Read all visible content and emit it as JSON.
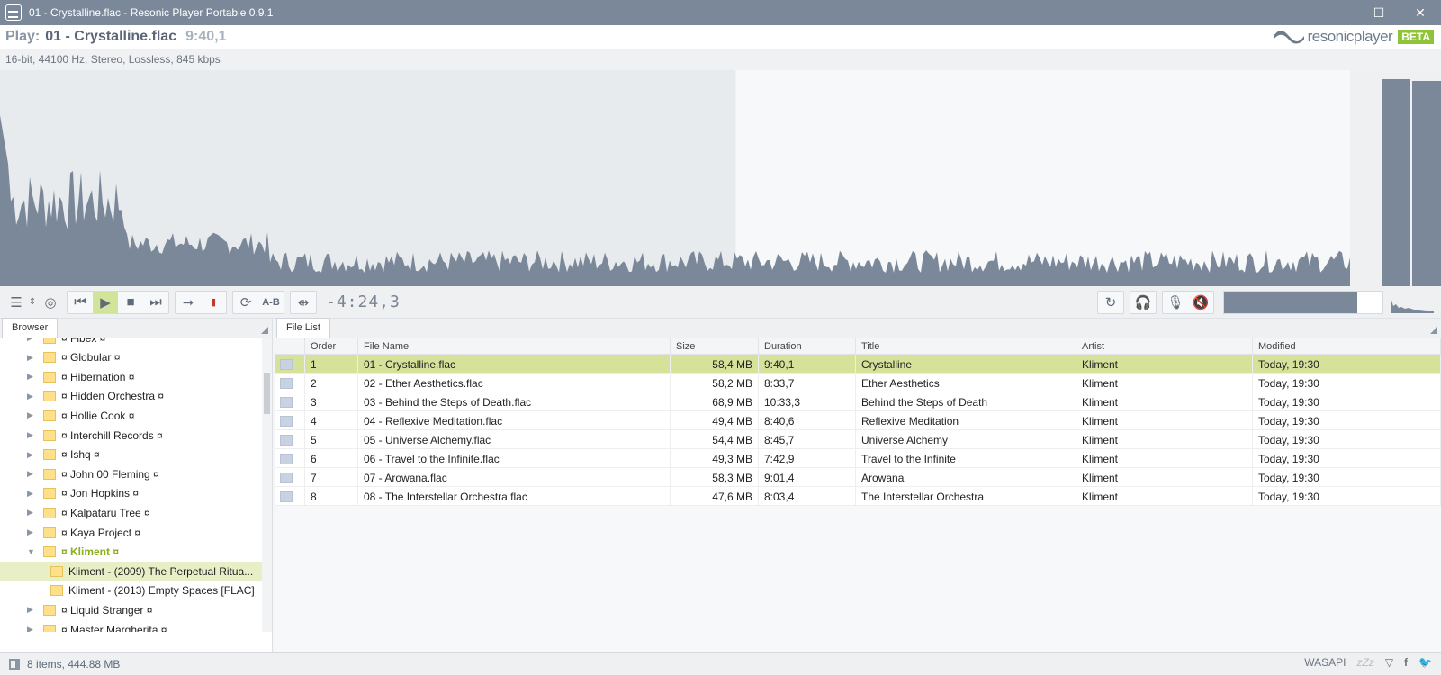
{
  "window": {
    "title": "01 - Crystalline.flac - Resonic Player Portable 0.9.1",
    "minimize": "—",
    "maximize": "☐",
    "close": "✕"
  },
  "header": {
    "play_label": "Play:",
    "file": "01 - Crystalline.flac",
    "time": "9:40,1",
    "brand": "resonicplayer",
    "beta": "BETA"
  },
  "info": "16-bit, 44100 Hz, Stereo, Lossless, 845 kbps",
  "playback": {
    "progress": 0.545,
    "volume": 0.84
  },
  "controls": {
    "time_remaining": "-4:24,3",
    "ab_label": "A-B"
  },
  "browser": {
    "tab": "Browser",
    "items": [
      {
        "label": "¤ Flbex ¤",
        "arrow": "▶"
      },
      {
        "label": "¤ Globular ¤",
        "arrow": "▶"
      },
      {
        "label": "¤ Hibernation ¤",
        "arrow": "▶"
      },
      {
        "label": "¤ Hidden Orchestra ¤",
        "arrow": "▶"
      },
      {
        "label": "¤ Hollie Cook ¤",
        "arrow": "▶"
      },
      {
        "label": "¤ Interchill Records ¤",
        "arrow": "▶"
      },
      {
        "label": "¤ Ishq ¤",
        "arrow": "▶"
      },
      {
        "label": "¤ John 00 Fleming ¤",
        "arrow": "▶"
      },
      {
        "label": "¤ Jon Hopkins ¤",
        "arrow": "▶"
      },
      {
        "label": "¤ Kalpataru Tree ¤",
        "arrow": "▶"
      },
      {
        "label": "¤ Kaya Project ¤",
        "arrow": "▶"
      },
      {
        "label": "¤ Kliment ¤",
        "arrow": "▼"
      },
      {
        "label": "Kliment - (2009) The Perpetual Ritua...",
        "arrow": ""
      },
      {
        "label": "Kliment - (2013) Empty Spaces [FLAC]",
        "arrow": ""
      },
      {
        "label": "¤ Liquid Stranger ¤",
        "arrow": "▶"
      },
      {
        "label": "¤ Master Margherita ¤",
        "arrow": "▶"
      }
    ]
  },
  "filelist": {
    "tab": "File List",
    "columns": [
      "",
      "Order",
      "File Name",
      "Size",
      "Duration",
      "Title",
      "Artist",
      "Modified"
    ],
    "rows": [
      [
        "1",
        "01 - Crystalline.flac",
        "58,4 MB",
        "9:40,1",
        "Crystalline",
        "Kliment",
        "Today, 19:30"
      ],
      [
        "2",
        "02 - Ether Aesthetics.flac",
        "58,2 MB",
        "8:33,7",
        "Ether Aesthetics",
        "Kliment",
        "Today, 19:30"
      ],
      [
        "3",
        "03 - Behind the Steps of Death.flac",
        "68,9 MB",
        "10:33,3",
        "Behind the Steps of Death",
        "Kliment",
        "Today, 19:30"
      ],
      [
        "4",
        "04 - Reflexive Meditation.flac",
        "49,4 MB",
        "8:40,6",
        "Reflexive Meditation",
        "Kliment",
        "Today, 19:30"
      ],
      [
        "5",
        "05 - Universe Alchemy.flac",
        "54,4 MB",
        "8:45,7",
        "Universe Alchemy",
        "Kliment",
        "Today, 19:30"
      ],
      [
        "6",
        "06 - Travel to the Infinite.flac",
        "49,3 MB",
        "7:42,9",
        "Travel to the Infinite",
        "Kliment",
        "Today, 19:30"
      ],
      [
        "7",
        "07 - Arowana.flac",
        "58,3 MB",
        "9:01,4",
        "Arowana",
        "Kliment",
        "Today, 19:30"
      ],
      [
        "8",
        "08 - The Interstellar Orchestra.flac",
        "47,6 MB",
        "8:03,4",
        "The Interstellar Orchestra",
        "Kliment",
        "Today, 19:30"
      ]
    ]
  },
  "status": {
    "items": "8 items, 444.88 MB",
    "output": "WASAPI",
    "sleep": "zZz"
  },
  "colors": {
    "accent": "#8fc33a",
    "playing_row": "#d6e29a",
    "waveform": "#7a8899",
    "titlebar": "#7a8899"
  }
}
